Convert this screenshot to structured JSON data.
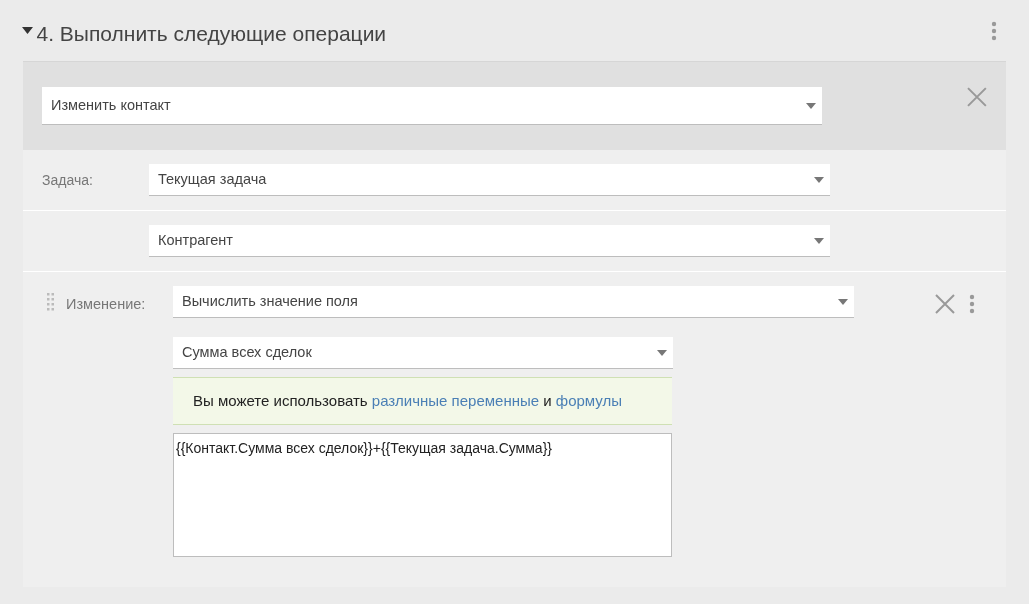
{
  "section": {
    "title": "4. Выполнить следующие операции",
    "expanded": true
  },
  "action": {
    "value": "Изменить контакт"
  },
  "rows": [
    {
      "label": "Задача:",
      "value": "Текущая задача"
    },
    {
      "value": "Контрагент"
    }
  ],
  "change": {
    "label": "Изменение:",
    "value": "Вычислить значение поля",
    "field": "Сумма всех сделок",
    "hint": [
      {
        "kind": "text",
        "text": "Вы можете использовать "
      },
      {
        "kind": "link",
        "text": "различные переменные"
      },
      {
        "kind": "text",
        "text": " и "
      },
      {
        "kind": "link",
        "text": "формулы"
      }
    ],
    "formula": "{{Контакт.Сумма всех сделок}}+{{Текущая задача.Сумма}}"
  }
}
